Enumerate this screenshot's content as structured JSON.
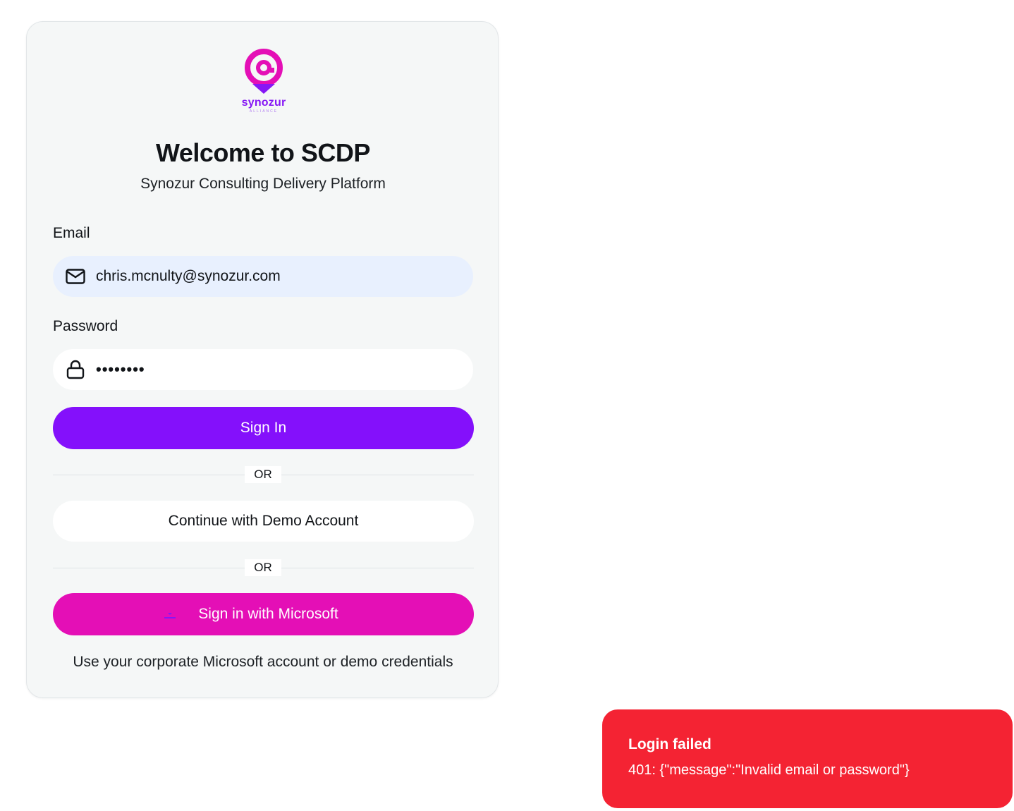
{
  "brand": {
    "logo_word": "synozur",
    "logo_sub": "ALLIANCE",
    "logo_colors": [
      "#e40fb6",
      "#8617f5"
    ]
  },
  "header": {
    "title": "Welcome to SCDP",
    "subtitle": "Synozur Consulting Delivery Platform"
  },
  "form": {
    "email_label": "Email",
    "email_value": "chris.mcnulty@synozur.com",
    "email_icon": "mail-icon",
    "password_label": "Password",
    "password_value": "••••••••",
    "password_icon": "lock-icon",
    "sign_in_label": "Sign In",
    "or_label_1": "OR",
    "demo_label": "Continue with Demo Account",
    "or_label_2": "OR",
    "microsoft_label": "Sign in with Microsoft",
    "microsoft_icon": "microsoft-icon",
    "note": "Use your corporate Microsoft account or demo credentials"
  },
  "toast": {
    "title": "Login failed",
    "message": "401: {\"message\":\"Invalid email or password\"}"
  },
  "colors": {
    "primary": "#8410fb",
    "microsoft_button": "#e40fb6",
    "error": "#f42333",
    "email_field_bg": "#e8f0fe"
  }
}
